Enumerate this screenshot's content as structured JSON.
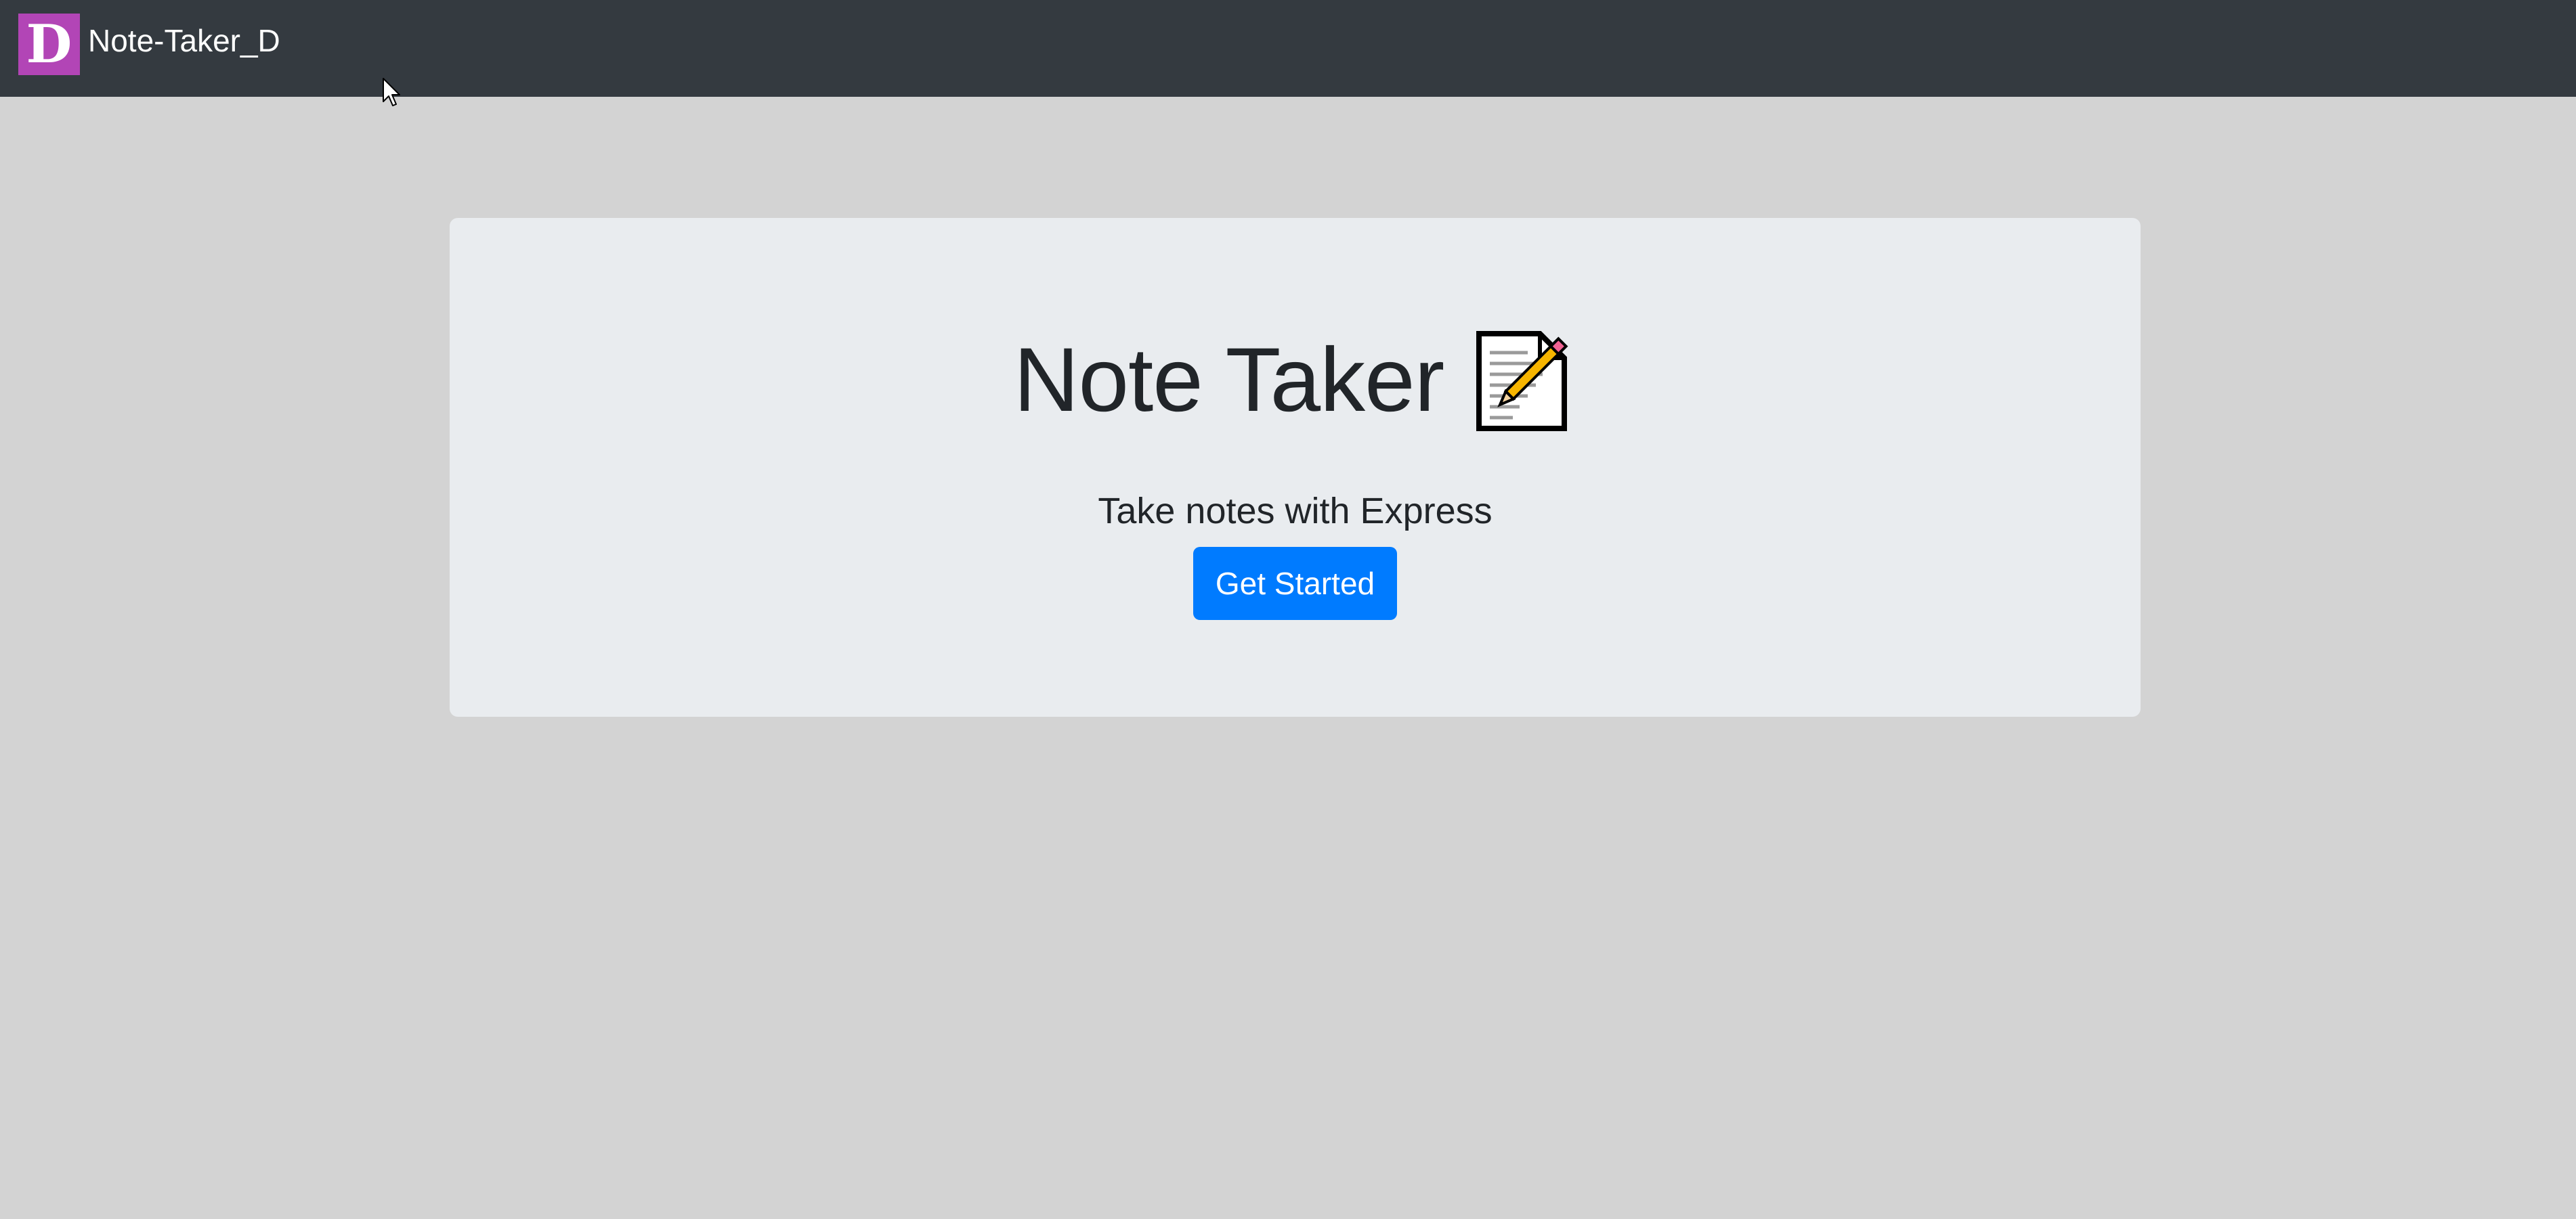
{
  "navbar": {
    "logo_letter": "D",
    "brand": "Note-Taker_D",
    "logo_color": "#b245b6",
    "background": "#343a40"
  },
  "hero": {
    "title": "Note Taker",
    "title_icon": "memo-icon",
    "subtitle": "Take notes with Express",
    "cta_label": "Get Started",
    "cta_color": "#007bff"
  },
  "page": {
    "background": "#d3d3d3",
    "card_background": "#e9ecef"
  }
}
